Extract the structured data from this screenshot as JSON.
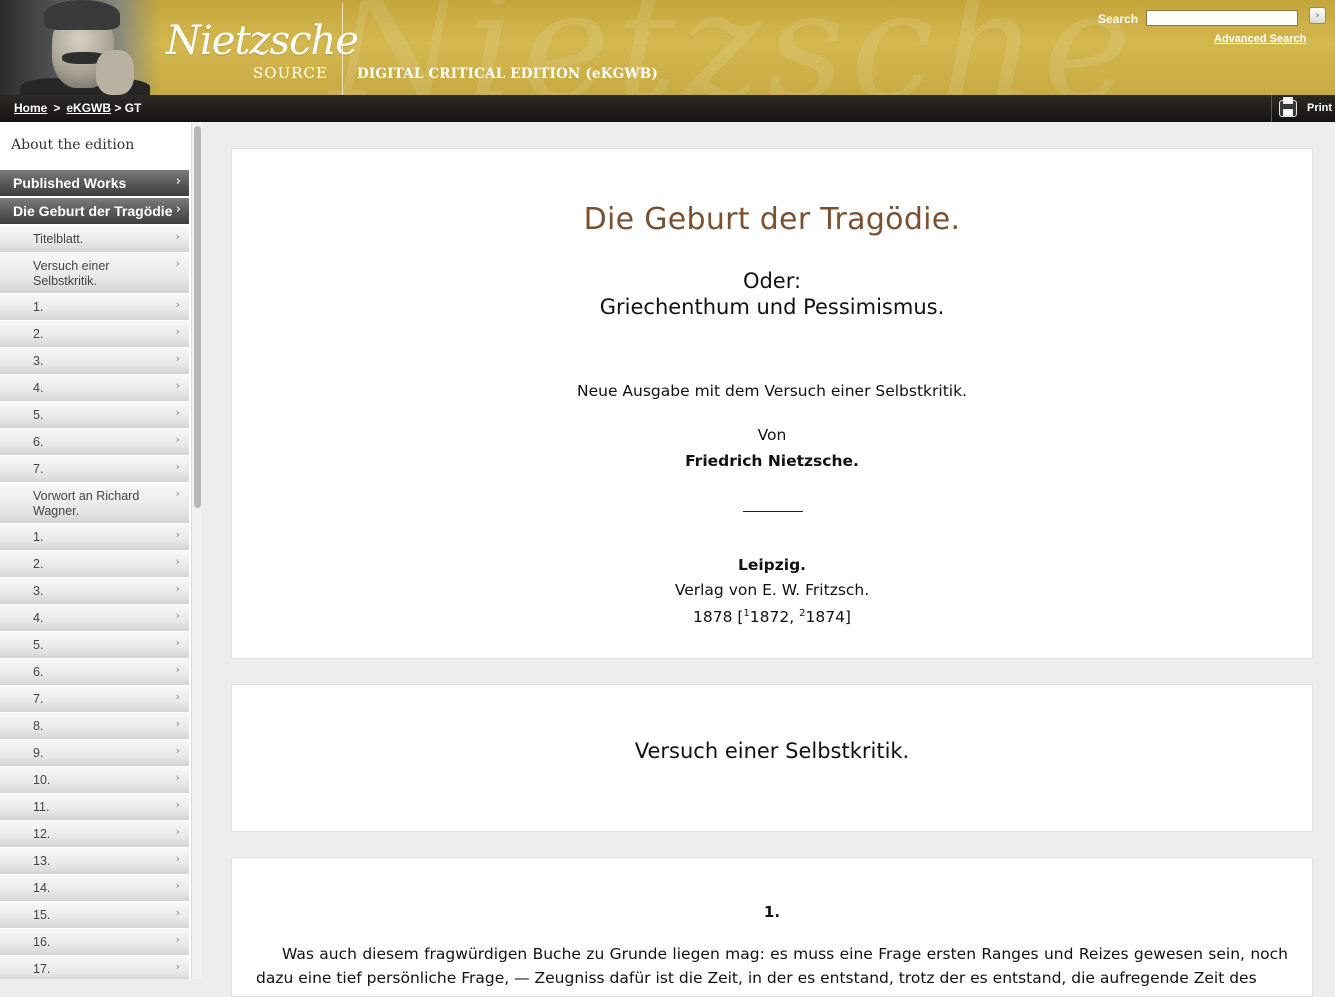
{
  "header": {
    "logo_script": "Nietzsche",
    "logo_source": "SOURCE",
    "watermark": "Nietzsche",
    "edition_title": "DIGITAL CRITICAL EDITION (eKGWB)",
    "search_label": "Search",
    "search_value": "",
    "search_go": "›",
    "advanced_search": "Advanced Search"
  },
  "breadcrumb": {
    "home": "Home",
    "sep": ">",
    "ekgwb": "eKGWB",
    "current": "> GT",
    "print": "Print"
  },
  "sidebar": {
    "about": "About the edition",
    "published_works": "Published Works",
    "current_work": "Die Geburt der Tragödie",
    "chevron": "›",
    "items": [
      "Titelblatt.",
      "Versuch einer Selbstkritik.",
      "1.",
      "2.",
      "3.",
      "4.",
      "5.",
      "6.",
      "7.",
      "Vorwort an Richard Wagner.",
      "1.",
      "2.",
      "3.",
      "4.",
      "5.",
      "6.",
      "7.",
      "8.",
      "9.",
      "10.",
      "11.",
      "12.",
      "13.",
      "14.",
      "15.",
      "16.",
      "17."
    ]
  },
  "title_page": {
    "title": "Die Geburt der Tragödie.",
    "subtitle_1": "Oder:",
    "subtitle_2": "Griechenthum und Pessimismus.",
    "edition_line": "Neue Ausgabe mit dem Versuch einer Selbstkritik.",
    "von": "Von",
    "author": "Friedrich Nietzsche.",
    "place": "Leipzig.",
    "publisher": "Verlag von E. W. Fritzsch.",
    "year": "1878 [",
    "sup_1": "1",
    "year_1": "1872, ",
    "sup_2": "2",
    "year_2": "1874]"
  },
  "section": {
    "title": "Versuch einer Selbstkritik."
  },
  "chapter": {
    "number": "1.",
    "text": "Was auch diesem fragwürdigen Buche zu Grunde liegen mag: es muss eine Frage ersten Ranges und Reizes gewesen sein, noch dazu eine tief persönliche Frage, — Zeugniss dafür ist die Zeit, in der es entstand, trotz der es entstand, die aufregende Zeit des"
  }
}
